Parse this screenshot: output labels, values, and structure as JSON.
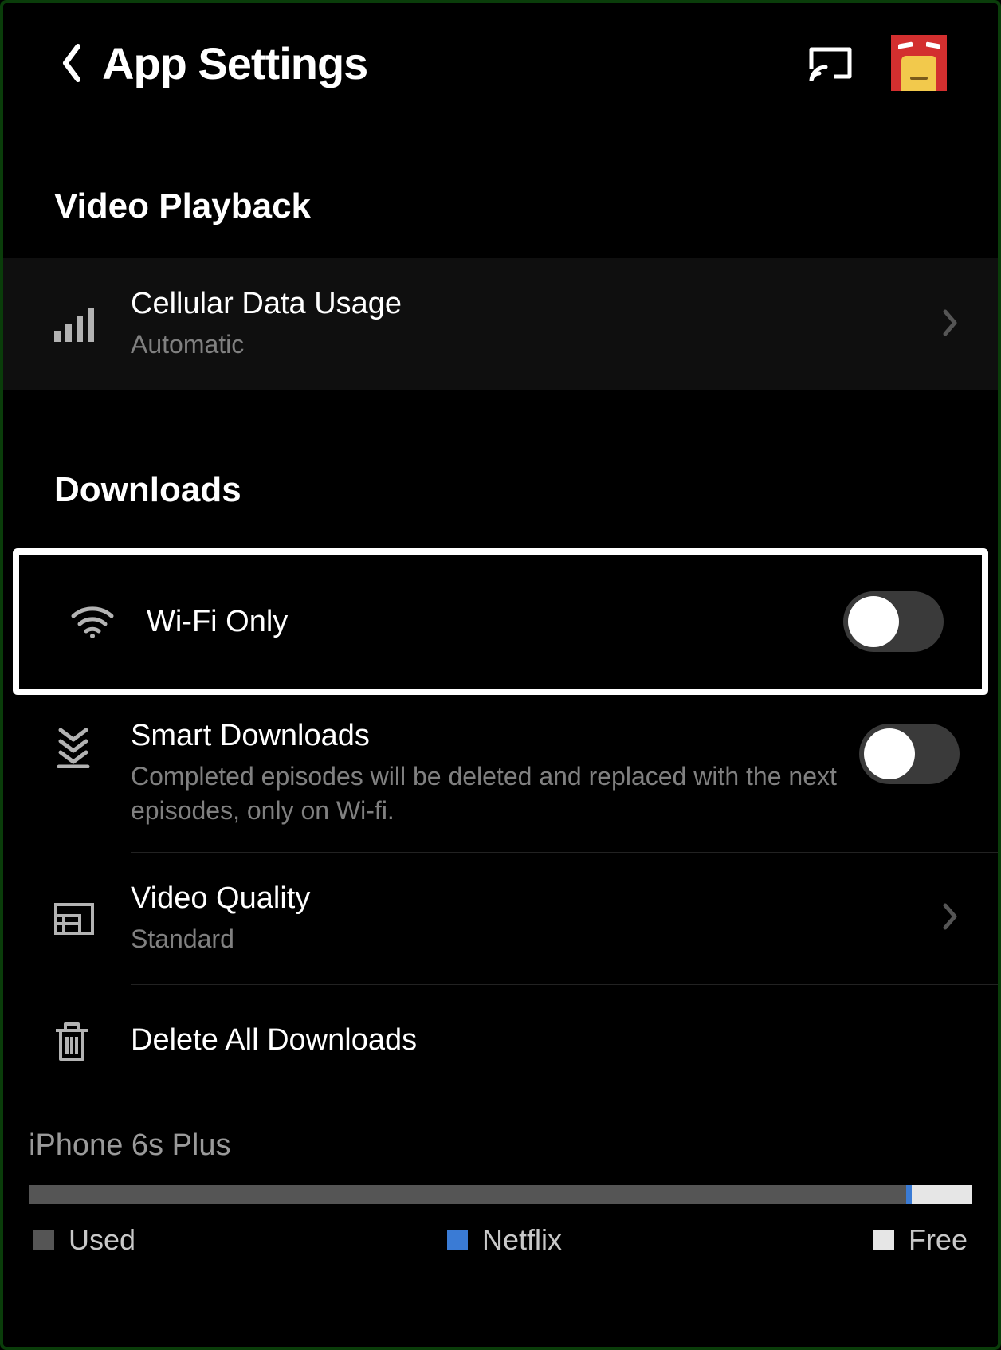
{
  "header": {
    "title": "App Settings"
  },
  "sections": {
    "video_playback": {
      "heading": "Video Playback",
      "cellular": {
        "title": "Cellular Data Usage",
        "value": "Automatic"
      }
    },
    "downloads": {
      "heading": "Downloads",
      "wifi_only": {
        "title": "Wi-Fi Only",
        "on": false
      },
      "smart_downloads": {
        "title": "Smart Downloads",
        "desc": "Completed episodes will be deleted and replaced with the next episodes, only on Wi-fi.",
        "on": false
      },
      "video_quality": {
        "title": "Video Quality",
        "value": "Standard"
      },
      "delete_all": {
        "title": "Delete All Downloads"
      }
    }
  },
  "storage": {
    "device": "iPhone 6s Plus",
    "legend": {
      "used": "Used",
      "netflix": "Netflix",
      "free": "Free"
    }
  }
}
